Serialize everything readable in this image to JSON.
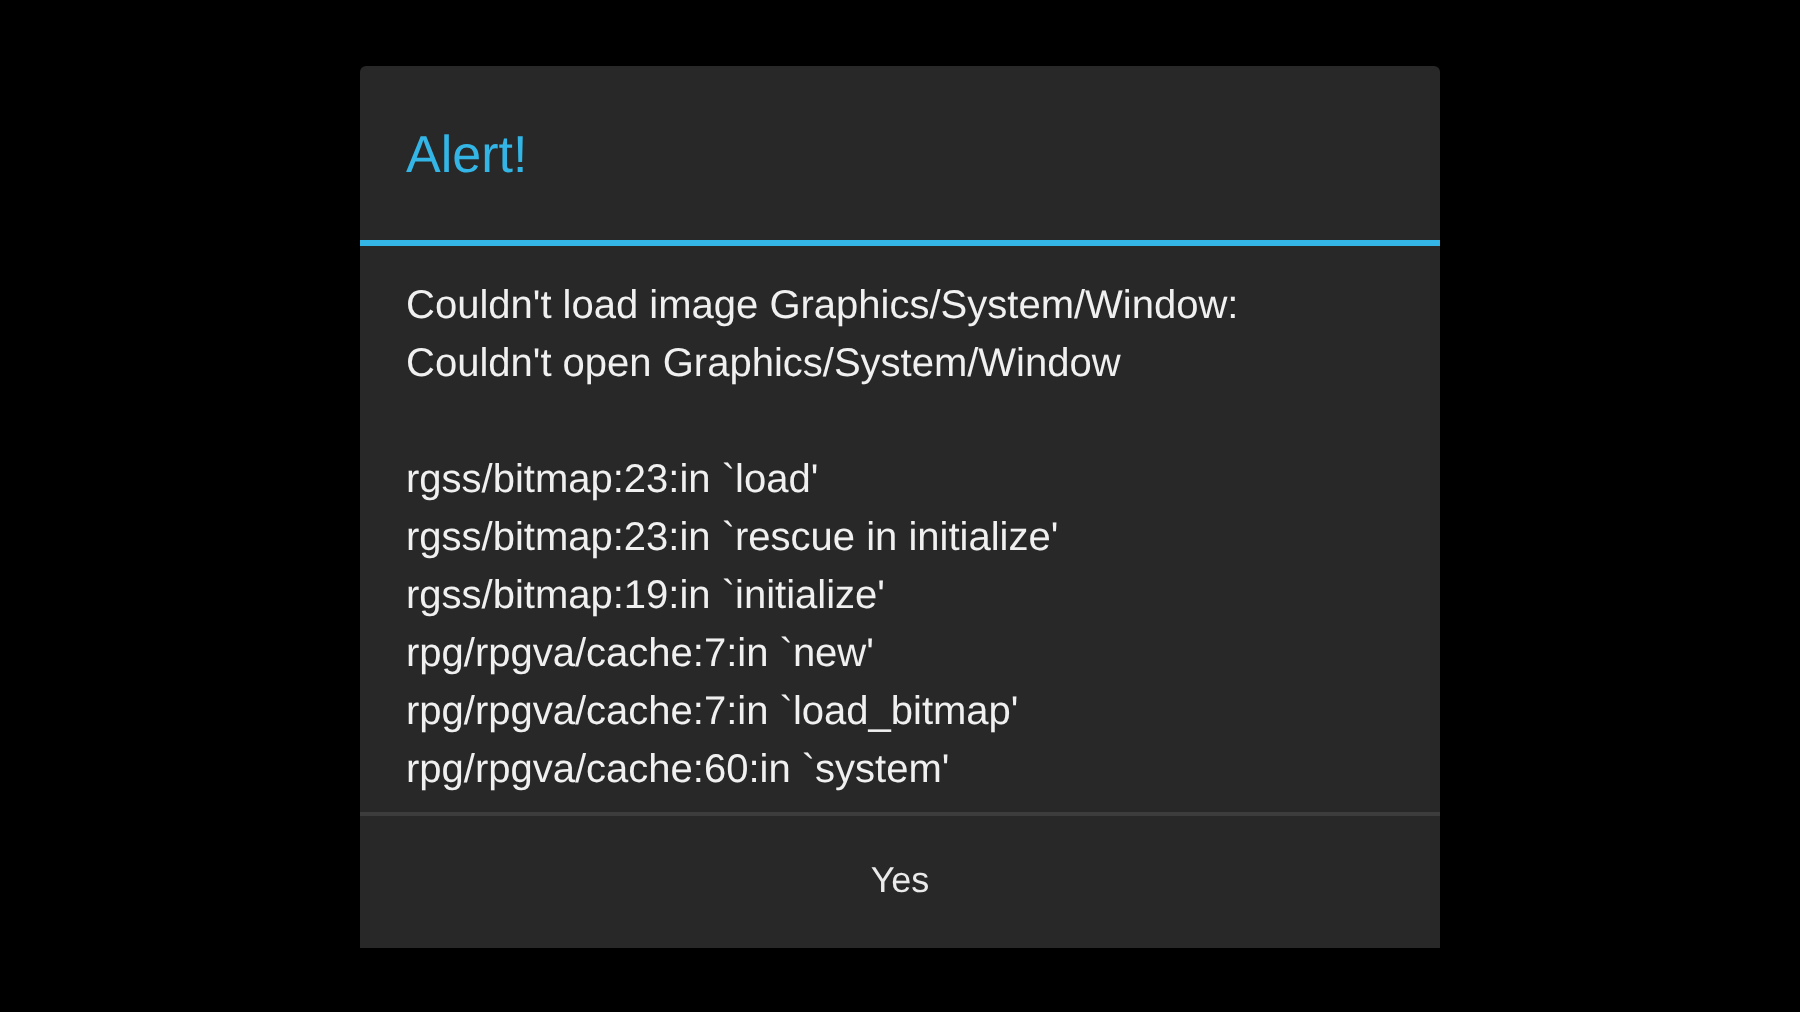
{
  "dialog": {
    "title": "Alert!",
    "message": "Couldn't load image Graphics/System/Window: Couldn't open Graphics/System/Window",
    "backtrace": [
      "rgss/bitmap:23:in `load'",
      "rgss/bitmap:23:in `rescue in initialize'",
      "rgss/bitmap:19:in `initialize'",
      "rpg/rpgva/cache:7:in `new'",
      "rpg/rpgva/cache:7:in `load_bitmap'",
      "rpg/rpgva/cache:60:in `system'"
    ],
    "buttons": [
      "Yes"
    ]
  }
}
